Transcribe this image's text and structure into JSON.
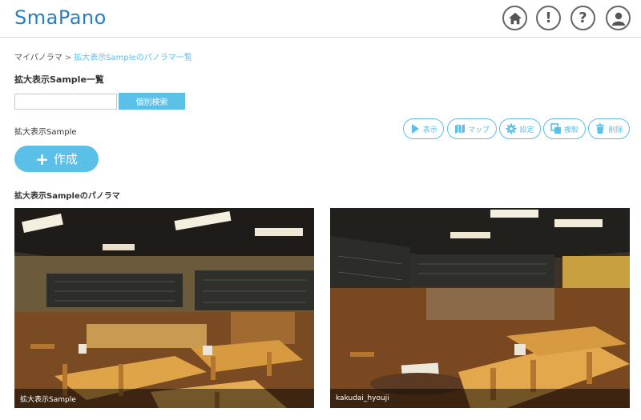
{
  "header": {
    "logo": "SmaPano",
    "icons": [
      "home-icon",
      "exclamation-icon",
      "question-icon",
      "user-icon"
    ],
    "exclamation": "!",
    "question": "?"
  },
  "breadcrumb": {
    "root": "マイパノラマ",
    "sep": ">",
    "current": "拡大表示Sampleのパノラマ一覧"
  },
  "list_title": "拡大表示Sample一覧",
  "search": {
    "value": "",
    "placeholder": "",
    "button_label": "個別検索"
  },
  "group_title": "拡大表示Sample",
  "actions": {
    "view": "表示",
    "map": "マップ",
    "settings": "設定",
    "copy": "複製",
    "delete": "削除"
  },
  "create": {
    "plus": "+",
    "label": "作成"
  },
  "panorama_section_title": "拡大表示Sampleのパノラマ",
  "panoramas": [
    {
      "caption": "拡大表示Sample"
    },
    {
      "caption": "kakudai_hyouji"
    }
  ],
  "colors": {
    "accent": "#5bc0e8",
    "logo": "#2a7fc1"
  }
}
